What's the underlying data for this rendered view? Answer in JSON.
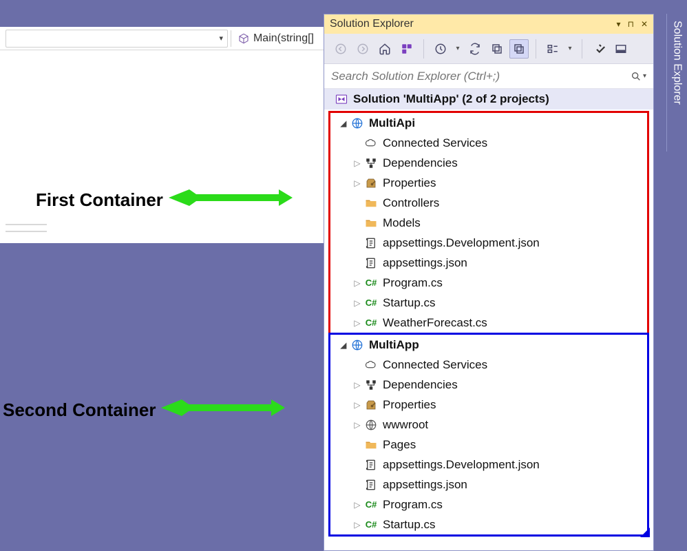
{
  "editor": {
    "method": "Main(string[]"
  },
  "panel": {
    "title": "Solution Explorer",
    "search_placeholder": "Search Solution Explorer (Ctrl+;)",
    "solution_label": "Solution 'MultiApp' (2 of 2 projects)"
  },
  "docktab": {
    "label": "Solution Explorer"
  },
  "annotations": {
    "first": "First Container",
    "second": "Second Container"
  },
  "projects": [
    {
      "name": "MultiApi",
      "items": [
        {
          "label": "Connected Services",
          "icon": "connected",
          "exp": "none"
        },
        {
          "label": "Dependencies",
          "icon": "deps",
          "exp": "right"
        },
        {
          "label": "Properties",
          "icon": "props",
          "exp": "right"
        },
        {
          "label": "Controllers",
          "icon": "folder",
          "exp": "none"
        },
        {
          "label": "Models",
          "icon": "folder",
          "exp": "none"
        },
        {
          "label": "appsettings.Development.json",
          "icon": "json",
          "exp": "none"
        },
        {
          "label": "appsettings.json",
          "icon": "json",
          "exp": "none"
        },
        {
          "label": "Program.cs",
          "icon": "cs",
          "exp": "right"
        },
        {
          "label": "Startup.cs",
          "icon": "cs",
          "exp": "right"
        },
        {
          "label": "WeatherForecast.cs",
          "icon": "cs",
          "exp": "right"
        }
      ]
    },
    {
      "name": "MultiApp",
      "items": [
        {
          "label": "Connected Services",
          "icon": "connected",
          "exp": "none"
        },
        {
          "label": "Dependencies",
          "icon": "deps",
          "exp": "right"
        },
        {
          "label": "Properties",
          "icon": "props",
          "exp": "right"
        },
        {
          "label": "wwwroot",
          "icon": "globe-gray",
          "exp": "right"
        },
        {
          "label": "Pages",
          "icon": "folder",
          "exp": "none"
        },
        {
          "label": "appsettings.Development.json",
          "icon": "json",
          "exp": "none"
        },
        {
          "label": "appsettings.json",
          "icon": "json",
          "exp": "none"
        },
        {
          "label": "Program.cs",
          "icon": "cs",
          "exp": "right"
        },
        {
          "label": "Startup.cs",
          "icon": "cs",
          "exp": "right"
        }
      ]
    }
  ]
}
